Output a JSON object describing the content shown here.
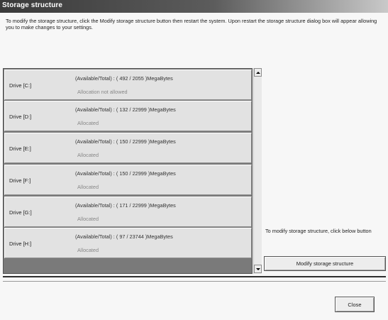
{
  "window": {
    "title": "Storage structure"
  },
  "description": "To modify the storage structure, click the Modify storage structure button then restart the system. Upon restart the storage structure dialog box will appear allowing you to make changes to your settings.",
  "drives": [
    {
      "label": "Drive [C:]",
      "info": "(Available/Total) : ( 492 / 2055 )MegaBytes",
      "status": "Allocation not allowed"
    },
    {
      "label": "Drive [D:]",
      "info": "(Available/Total) : ( 132 / 22999 )MegaBytes",
      "status": "Allocated"
    },
    {
      "label": "Drive [E:]",
      "info": "(Available/Total) : ( 150 / 22999 )MegaBytes",
      "status": "Allocated"
    },
    {
      "label": "Drive [F:]",
      "info": "(Available/Total) : ( 150 / 22999 )MegaBytes",
      "status": "Allocated"
    },
    {
      "label": "Drive [G:]",
      "info": "(Available/Total) : ( 171 / 22999 )MegaBytes",
      "status": "Allocated"
    },
    {
      "label": "Drive [H:]",
      "info": "(Available/Total) : ( 97 / 23744 )MegaBytes",
      "status": "Allocated"
    }
  ],
  "scrollbar": {
    "up_icon": "arrow-up-icon",
    "down_icon": "arrow-down-icon"
  },
  "side_panel": {
    "hint": "To modify storage structure, click below button",
    "modify_label": "Modify storage structure"
  },
  "footer": {
    "close_label": "Close"
  },
  "colors": {
    "title_bar_dark": "#3a3a3a",
    "row_background": "#e2e2e2",
    "list_background": "#7a7a7a",
    "status_text": "#888888"
  }
}
